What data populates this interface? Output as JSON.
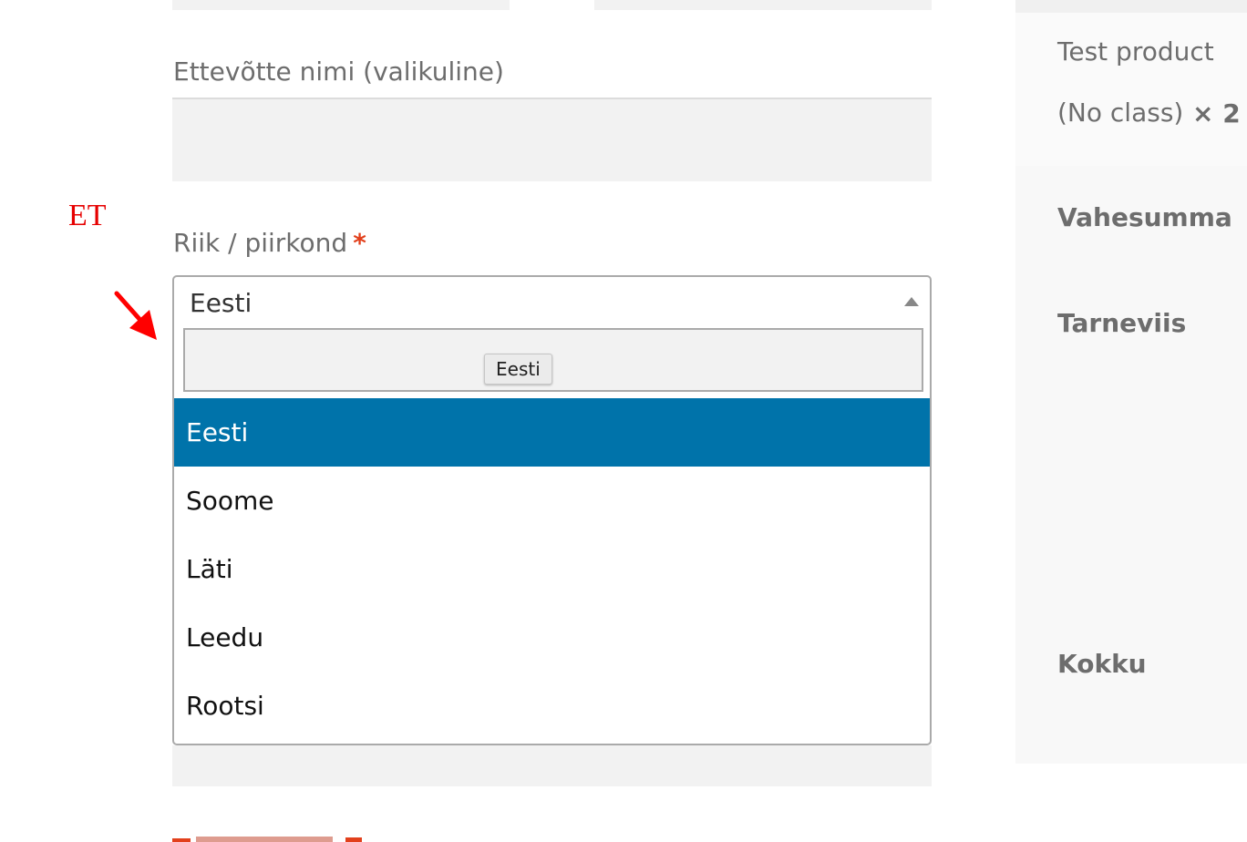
{
  "form": {
    "company_label": "Ettevõtte nimi (valikuline)",
    "company_value": "",
    "country_label": "Riik / piirkond",
    "required_mark": "*"
  },
  "annotation": {
    "text": "ET",
    "color": "#e60000"
  },
  "country_select": {
    "selected_value": "Eesti",
    "search_value": "",
    "search_tooltip": "Eesti",
    "options": [
      {
        "label": "Eesti",
        "highlighted": true
      },
      {
        "label": "Soome",
        "highlighted": false
      },
      {
        "label": "Läti",
        "highlighted": false
      },
      {
        "label": "Leedu",
        "highlighted": false
      },
      {
        "label": "Rootsi",
        "highlighted": false
      }
    ],
    "highlight_color": "#0073aa"
  },
  "order_summary": {
    "product_name": "Test product",
    "product_class": "(No class)",
    "product_qty": "× 2",
    "subtotal_label": "Vahesumma",
    "shipping_label": "Tarneviis",
    "total_label": "Kokku"
  }
}
